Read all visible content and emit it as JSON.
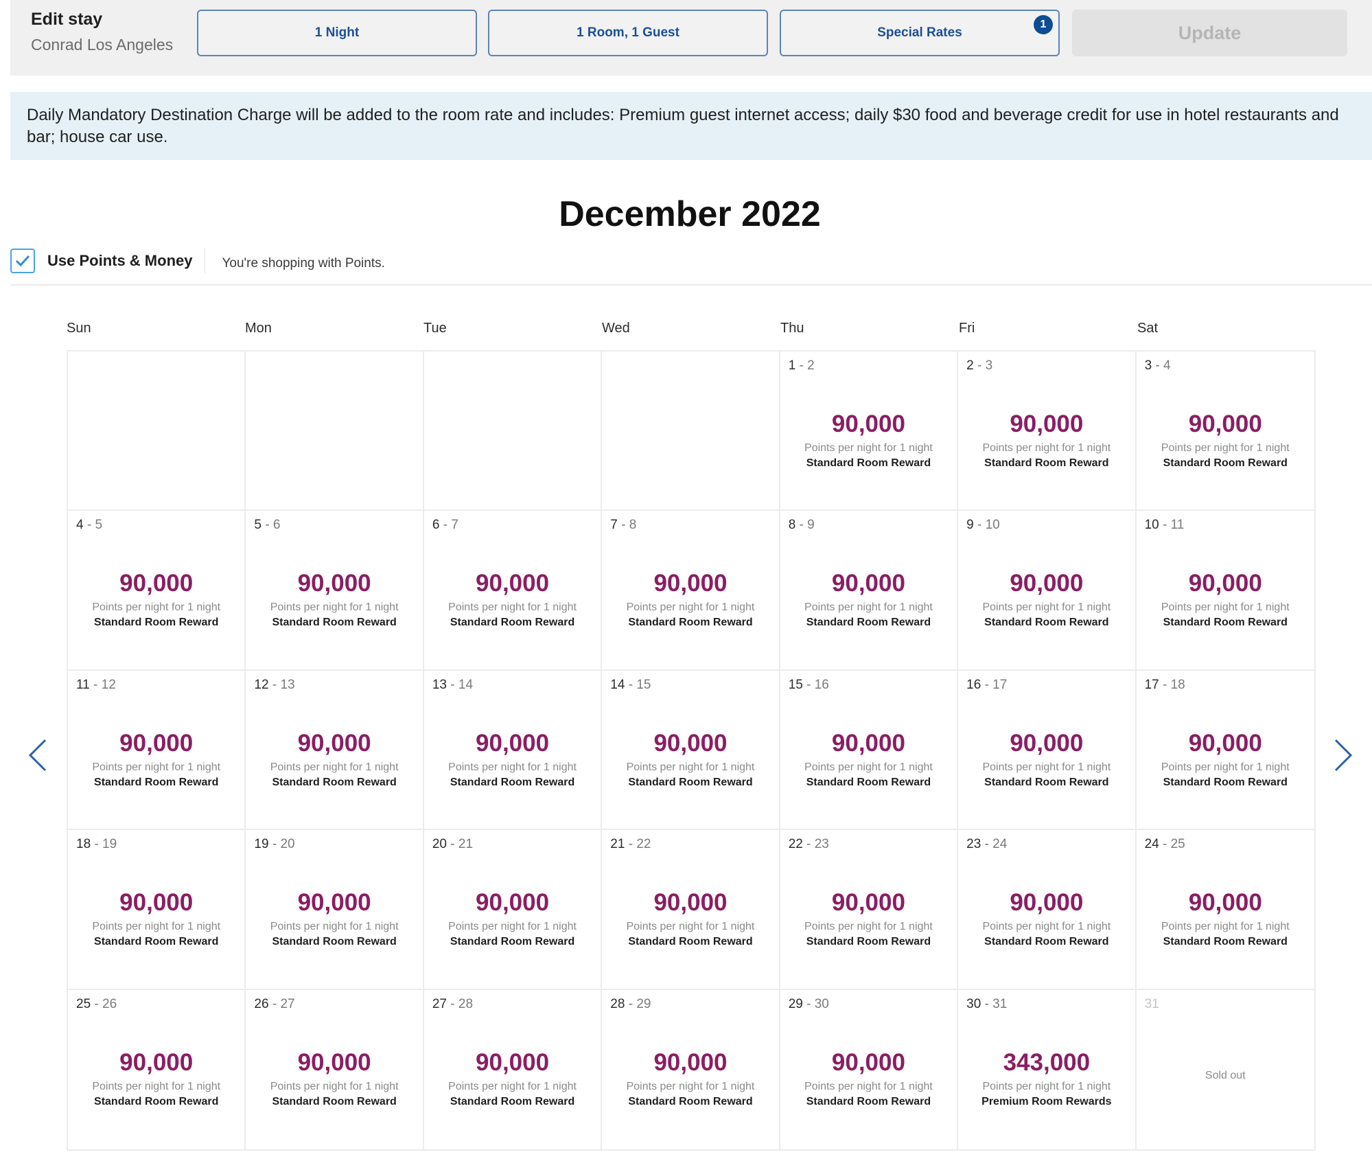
{
  "header": {
    "title": "Edit stay",
    "hotel": "Conrad Los Angeles",
    "nights_button": "1 Night",
    "rooms_guests_button": "1 Room, 1 Guest",
    "special_rates_button": "Special Rates",
    "special_rates_badge": "1",
    "update_button": "Update"
  },
  "banner": {
    "text": "Daily Mandatory Destination Charge will be added to the room rate and includes: Premium guest internet access; daily $30 food and beverage credit for use in hotel restaurants and bar; house car use."
  },
  "calendar": {
    "month_title": "December 2022",
    "use_points_money_label": "Use Points & Money",
    "use_points_money_checked": true,
    "shopping_note": "You're shopping with Points.",
    "weekdays": [
      "Sun",
      "Mon",
      "Tue",
      "Wed",
      "Thu",
      "Fri",
      "Sat"
    ],
    "cells": [
      {
        "empty": true
      },
      {
        "empty": true
      },
      {
        "empty": true
      },
      {
        "empty": true
      },
      {
        "from": "1",
        "to": "2",
        "points": "90,000",
        "note": "Points per night for 1 night",
        "type": "Standard Room Reward"
      },
      {
        "from": "2",
        "to": "3",
        "points": "90,000",
        "note": "Points per night for 1 night",
        "type": "Standard Room Reward"
      },
      {
        "from": "3",
        "to": "4",
        "points": "90,000",
        "note": "Points per night for 1 night",
        "type": "Standard Room Reward"
      },
      {
        "from": "4",
        "to": "5",
        "points": "90,000",
        "note": "Points per night for 1 night",
        "type": "Standard Room Reward"
      },
      {
        "from": "5",
        "to": "6",
        "points": "90,000",
        "note": "Points per night for 1 night",
        "type": "Standard Room Reward"
      },
      {
        "from": "6",
        "to": "7",
        "points": "90,000",
        "note": "Points per night for 1 night",
        "type": "Standard Room Reward"
      },
      {
        "from": "7",
        "to": "8",
        "points": "90,000",
        "note": "Points per night for 1 night",
        "type": "Standard Room Reward"
      },
      {
        "from": "8",
        "to": "9",
        "points": "90,000",
        "note": "Points per night for 1 night",
        "type": "Standard Room Reward"
      },
      {
        "from": "9",
        "to": "10",
        "points": "90,000",
        "note": "Points per night for 1 night",
        "type": "Standard Room Reward"
      },
      {
        "from": "10",
        "to": "11",
        "points": "90,000",
        "note": "Points per night for 1 night",
        "type": "Standard Room Reward"
      },
      {
        "from": "11",
        "to": "12",
        "points": "90,000",
        "note": "Points per night for 1 night",
        "type": "Standard Room Reward"
      },
      {
        "from": "12",
        "to": "13",
        "points": "90,000",
        "note": "Points per night for 1 night",
        "type": "Standard Room Reward"
      },
      {
        "from": "13",
        "to": "14",
        "points": "90,000",
        "note": "Points per night for 1 night",
        "type": "Standard Room Reward"
      },
      {
        "from": "14",
        "to": "15",
        "points": "90,000",
        "note": "Points per night for 1 night",
        "type": "Standard Room Reward"
      },
      {
        "from": "15",
        "to": "16",
        "points": "90,000",
        "note": "Points per night for 1 night",
        "type": "Standard Room Reward"
      },
      {
        "from": "16",
        "to": "17",
        "points": "90,000",
        "note": "Points per night for 1 night",
        "type": "Standard Room Reward"
      },
      {
        "from": "17",
        "to": "18",
        "points": "90,000",
        "note": "Points per night for 1 night",
        "type": "Standard Room Reward"
      },
      {
        "from": "18",
        "to": "19",
        "points": "90,000",
        "note": "Points per night for 1 night",
        "type": "Standard Room Reward"
      },
      {
        "from": "19",
        "to": "20",
        "points": "90,000",
        "note": "Points per night for 1 night",
        "type": "Standard Room Reward"
      },
      {
        "from": "20",
        "to": "21",
        "points": "90,000",
        "note": "Points per night for 1 night",
        "type": "Standard Room Reward"
      },
      {
        "from": "21",
        "to": "22",
        "points": "90,000",
        "note": "Points per night for 1 night",
        "type": "Standard Room Reward"
      },
      {
        "from": "22",
        "to": "23",
        "points": "90,000",
        "note": "Points per night for 1 night",
        "type": "Standard Room Reward"
      },
      {
        "from": "23",
        "to": "24",
        "points": "90,000",
        "note": "Points per night for 1 night",
        "type": "Standard Room Reward"
      },
      {
        "from": "24",
        "to": "25",
        "points": "90,000",
        "note": "Points per night for 1 night",
        "type": "Standard Room Reward"
      },
      {
        "from": "25",
        "to": "26",
        "points": "90,000",
        "note": "Points per night for 1 night",
        "type": "Standard Room Reward"
      },
      {
        "from": "26",
        "to": "27",
        "points": "90,000",
        "note": "Points per night for 1 night",
        "type": "Standard Room Reward"
      },
      {
        "from": "27",
        "to": "28",
        "points": "90,000",
        "note": "Points per night for 1 night",
        "type": "Standard Room Reward"
      },
      {
        "from": "28",
        "to": "29",
        "points": "90,000",
        "note": "Points per night for 1 night",
        "type": "Standard Room Reward"
      },
      {
        "from": "29",
        "to": "30",
        "points": "90,000",
        "note": "Points per night for 1 night",
        "type": "Standard Room Reward"
      },
      {
        "from": "30",
        "to": "31",
        "points": "343,000",
        "note": "Points per night for 1 night",
        "type": "Premium Room Rewards"
      },
      {
        "from": "31",
        "sold_out": "Sold out"
      }
    ]
  },
  "colors": {
    "points": "#8a1e62",
    "accent_blue": "#1c4f97",
    "banner_bg": "#e5f1f6"
  },
  "icons": {
    "prev": "chevron-left-icon",
    "next": "chevron-right-icon",
    "check": "checkmark-icon"
  }
}
